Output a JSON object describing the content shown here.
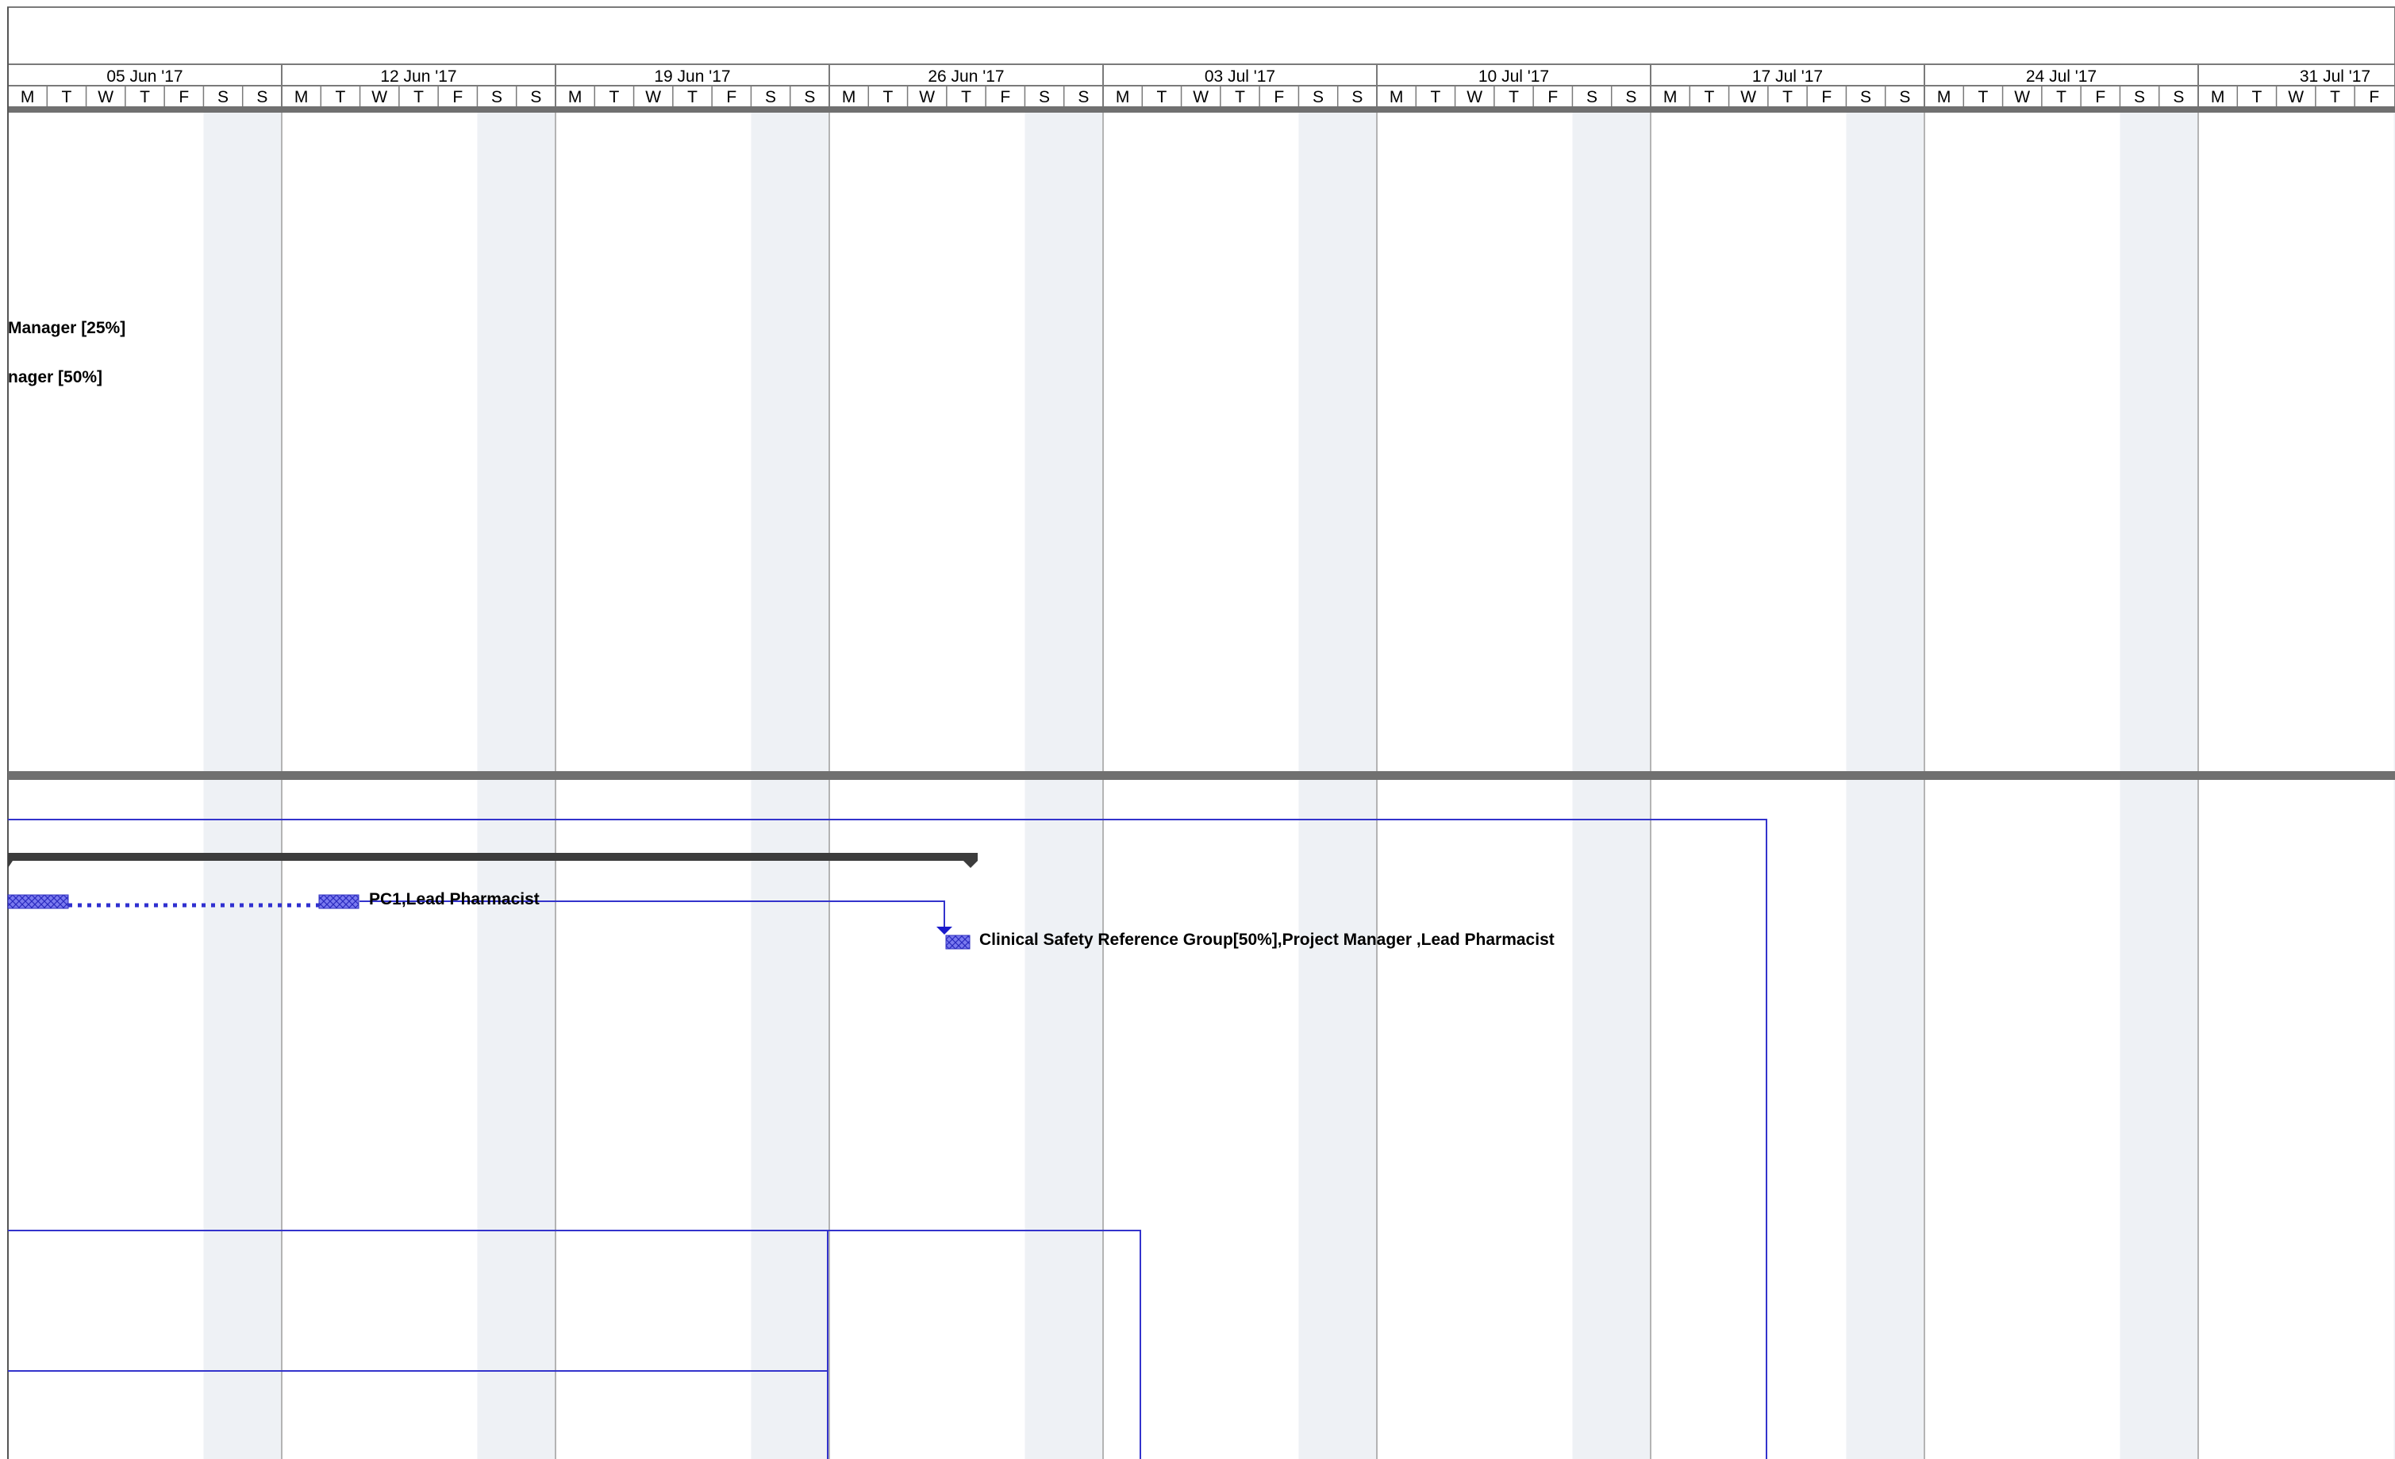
{
  "timescale": {
    "weeks": [
      "05 Jun '17",
      "12 Jun '17",
      "19 Jun '17",
      "26 Jun '17",
      "03 Jul '17",
      "10 Jul '17",
      "17 Jul '17",
      "24 Jul '17",
      "31 Jul '17"
    ],
    "day_letters": [
      "M",
      "T",
      "W",
      "T",
      "F",
      "S",
      "S"
    ]
  },
  "top_pane": {
    "labels": [
      {
        "text": "Manager [25%]"
      },
      {
        "text": "nager [50%]"
      }
    ]
  },
  "bottom_pane": {
    "bar_labels": [
      {
        "text": "PC1,Lead Pharmacist"
      },
      {
        "text": "Clinical Safety Reference Group[50%],Project Manager ,Lead Pharmacist"
      }
    ]
  },
  "colors": {
    "weekend_shading": "#eef1f5",
    "task_bar": "#5a5ae0",
    "link_line": "#3333cc",
    "summary_bar": "#3c3c3c",
    "pane_divider": "#707070",
    "grid_line": "#b4b4b4"
  }
}
